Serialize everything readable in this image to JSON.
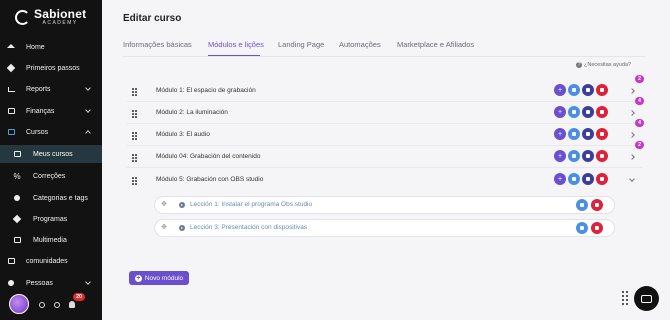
{
  "brand": {
    "name": "Sabionet",
    "subtitle": "ACADEMY"
  },
  "sidebar": {
    "items": [
      {
        "label": "Home",
        "icon": "home-icon"
      },
      {
        "label": "Primeiros passos",
        "icon": "rocket-icon"
      },
      {
        "label": "Reports",
        "icon": "chart-icon",
        "expandable": true
      },
      {
        "label": "Finanças",
        "icon": "money-icon",
        "expandable": true
      },
      {
        "label": "Cursos",
        "icon": "courses-icon",
        "expanded": true
      },
      {
        "label": "Meus cursos",
        "icon": "course-icon",
        "sub": true,
        "active": true
      },
      {
        "label": "Correções",
        "icon": "percent-icon",
        "sub": true
      },
      {
        "label": "Categorias e tags",
        "icon": "tags-icon",
        "sub": true
      },
      {
        "label": "Programas",
        "icon": "layers-icon",
        "sub": true
      },
      {
        "label": "Multimedia",
        "icon": "media-icon",
        "sub": true
      },
      {
        "label": "comunidades",
        "icon": "community-icon"
      },
      {
        "label": "Pessoas",
        "icon": "people-icon",
        "expandable": true
      }
    ],
    "footer": {
      "notifications_count": "20"
    }
  },
  "main": {
    "title": "Editar curso",
    "tabs": [
      {
        "label": "Informações básicas"
      },
      {
        "label": "Módulos e lições",
        "active": true
      },
      {
        "label": "Landing Page"
      },
      {
        "label": "Automações"
      },
      {
        "label": "Marketplace e Afiliados"
      }
    ],
    "help_text": "¿Necesitas ayuda?",
    "modules": [
      {
        "title": "Módulo 1: El espacio de grabación",
        "count": "2"
      },
      {
        "title": "Módulo 2: La iluminación",
        "count": "4"
      },
      {
        "title": "Módulo 3: El audio",
        "count": "4"
      },
      {
        "title": "Módulo 04: Grabación del contenido",
        "count": "2"
      },
      {
        "title": "Módulo 5: Grabación con OBS studio",
        "count": "2",
        "expanded": true
      }
    ],
    "lessons": [
      {
        "title": "Lección 1: Instalar el programa Obs studio"
      },
      {
        "title": "Lección 3: Presentación con dispositivas"
      }
    ],
    "new_module_label": "Novo módulo"
  },
  "colors": {
    "accent": "#6c4fd3",
    "sidebar_bg": "#121212",
    "active_item_bg": "#26383f",
    "delete": "#e0213a",
    "edit": "#4a90e2",
    "lock": "#3b3f9a",
    "count_badge": "#c837c8"
  }
}
